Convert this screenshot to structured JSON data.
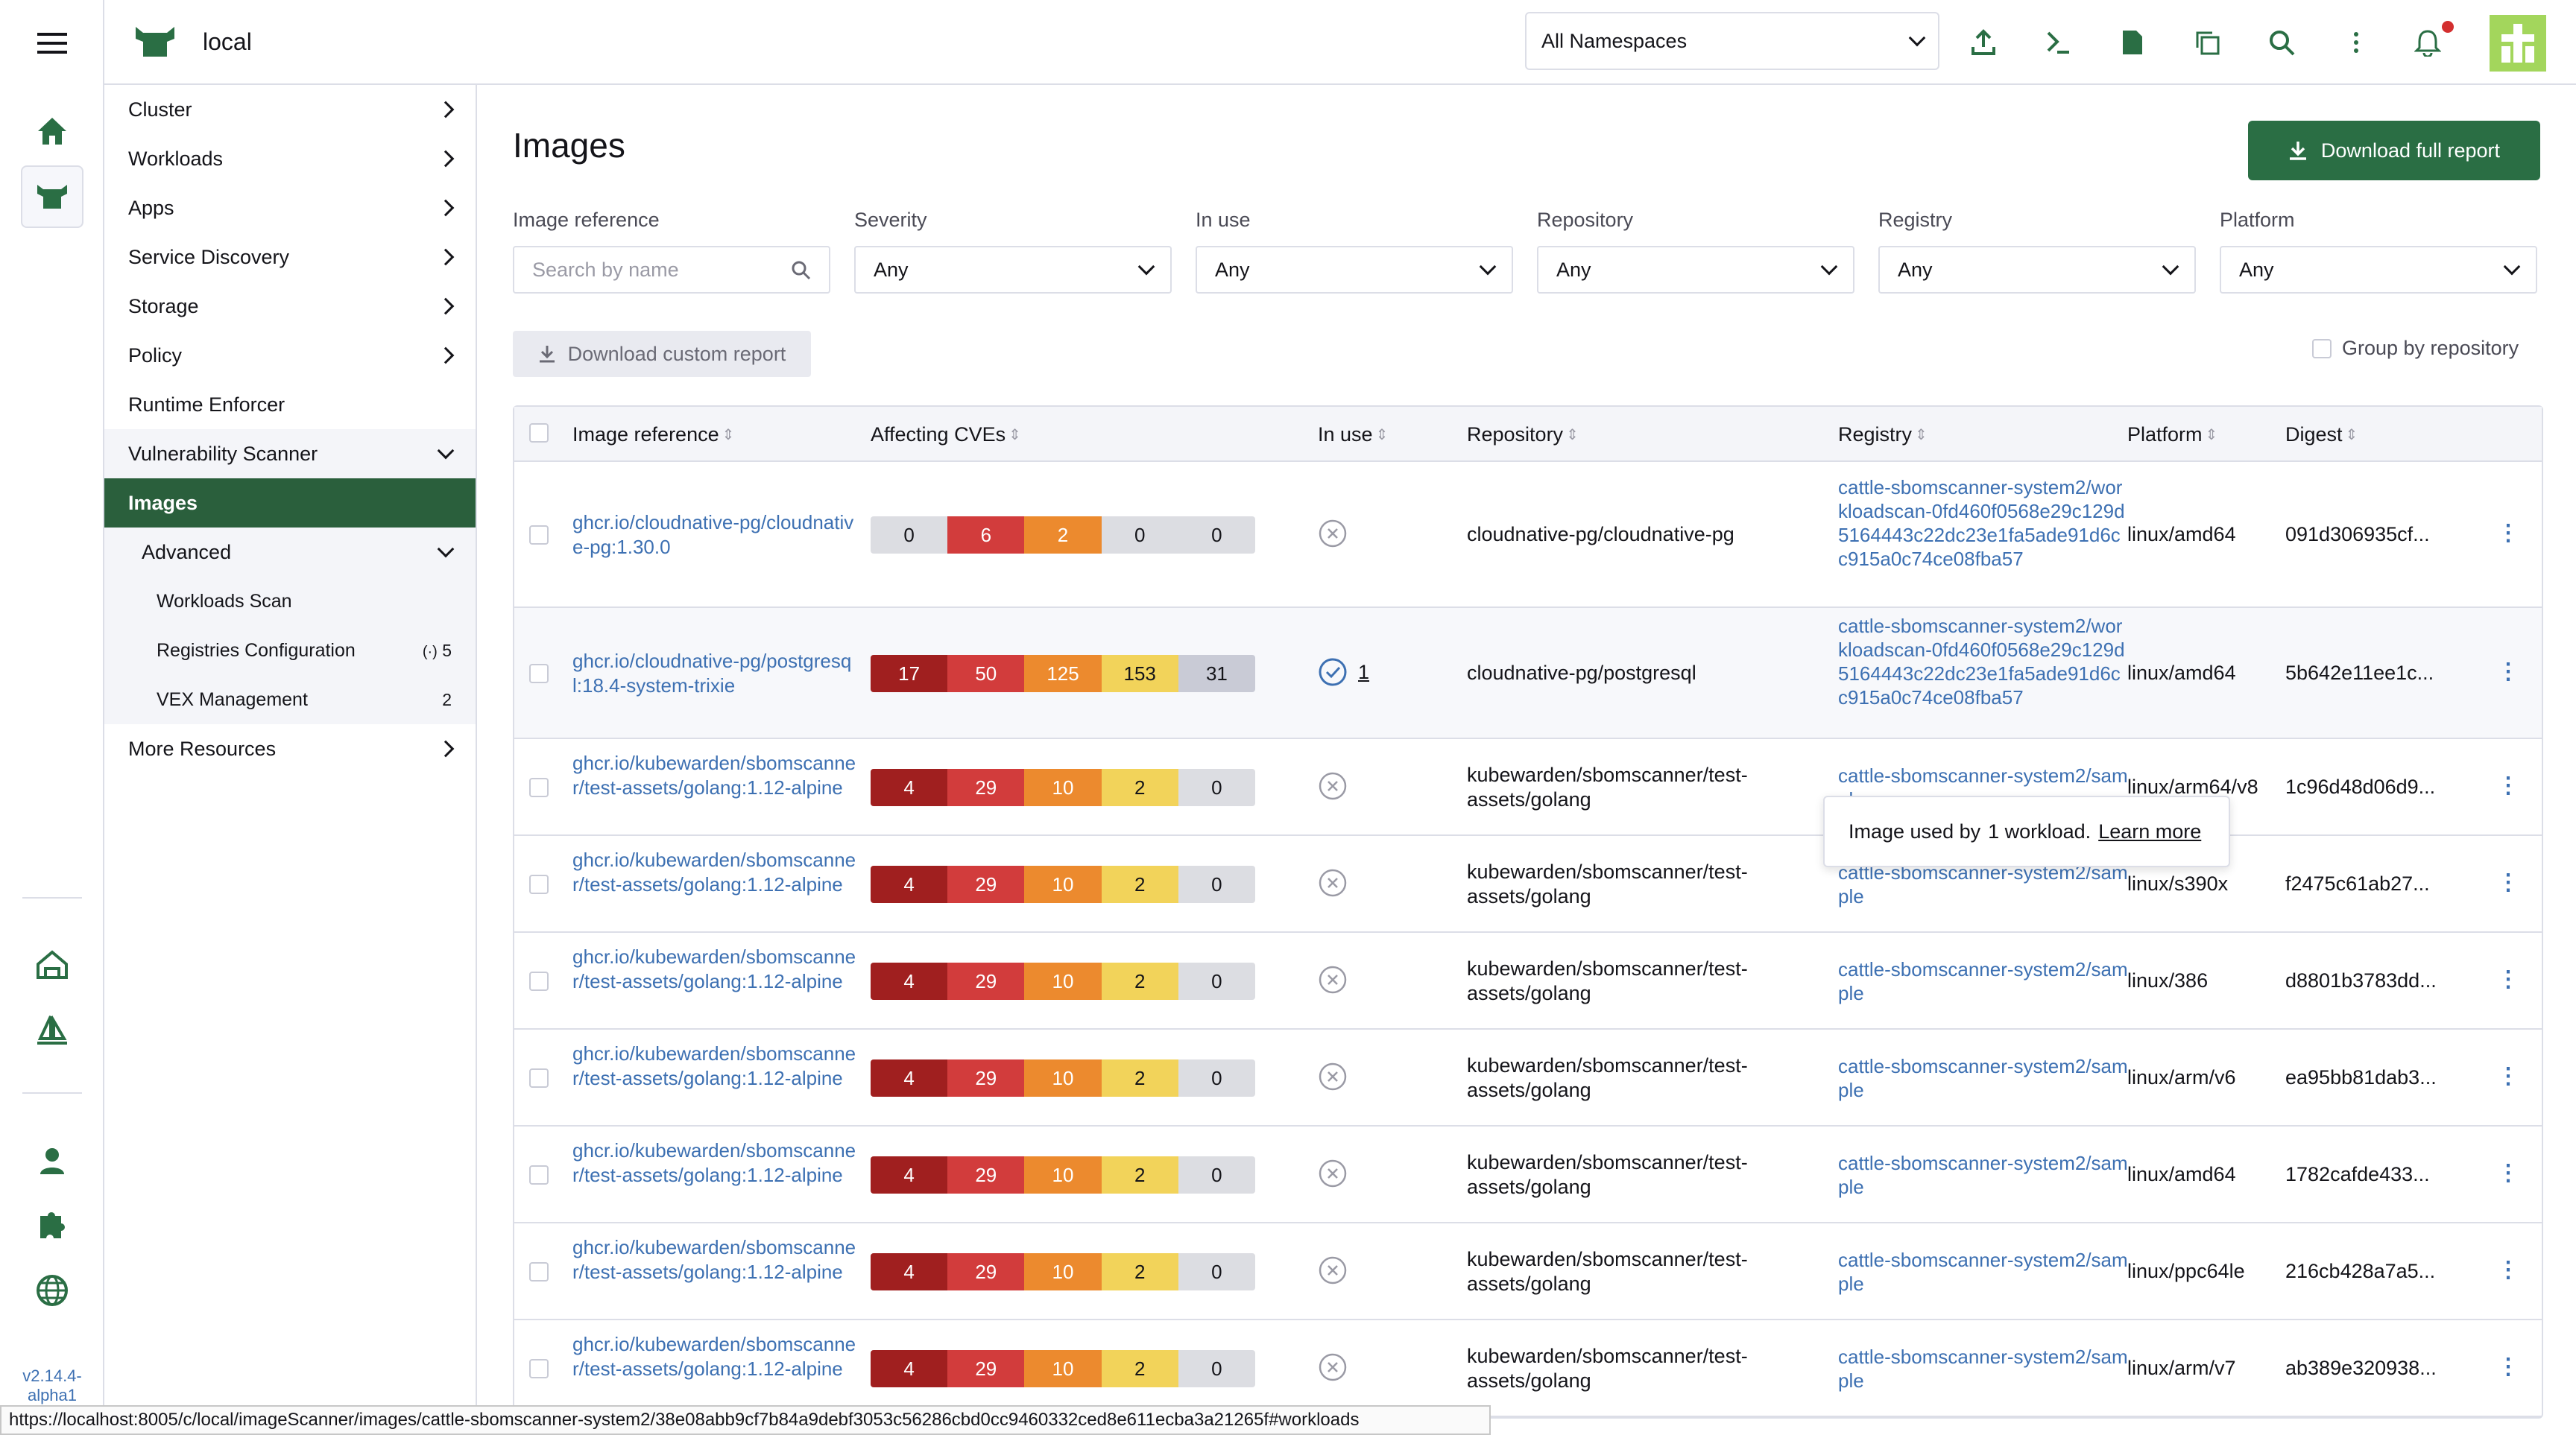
{
  "app": {
    "cluster_name": "local",
    "version": "v2.14.4-\nalpha1",
    "colors": {
      "primary": "#2a6e44",
      "link": "#3d70b2",
      "selected_nav": "#2a5f3c"
    }
  },
  "header": {
    "namespace_select": "All Namespaces",
    "icons": [
      "upload-icon",
      "terminal-icon",
      "file-icon",
      "copy-icon",
      "search-icon",
      "more-icon",
      "bell-icon"
    ]
  },
  "nav": {
    "items": [
      {
        "label": "Cluster",
        "chevron": "right"
      },
      {
        "label": "Workloads",
        "chevron": "right"
      },
      {
        "label": "Apps",
        "chevron": "right"
      },
      {
        "label": "Service Discovery",
        "chevron": "right"
      },
      {
        "label": "Storage",
        "chevron": "right"
      },
      {
        "label": "Policy",
        "chevron": "right"
      },
      {
        "label": "Runtime Enforcer",
        "chevron": ""
      },
      {
        "label": "Vulnerability Scanner",
        "chevron": "down"
      },
      {
        "label": "Images",
        "chevron": ""
      },
      {
        "label": "Advanced",
        "chevron": "down"
      },
      {
        "label": "Workloads Scan",
        "badge": ""
      },
      {
        "label": "Registries Configuration",
        "badge": "5"
      },
      {
        "label": "VEX Management",
        "badge": "2"
      },
      {
        "label": "More Resources",
        "chevron": "right"
      }
    ]
  },
  "page": {
    "title": "Images",
    "download_full": "Download full report",
    "download_custom": "Download custom report",
    "group_by": "Group by repository",
    "filters": [
      {
        "label": "Image reference",
        "value": "",
        "placeholder": "Search by name"
      },
      {
        "label": "Severity",
        "value": "Any"
      },
      {
        "label": "In use",
        "value": "Any"
      },
      {
        "label": "Repository",
        "value": "Any"
      },
      {
        "label": "Registry",
        "value": "Any"
      },
      {
        "label": "Platform",
        "value": "Any"
      }
    ]
  },
  "table": {
    "columns": [
      "Image reference",
      "Affecting CVEs",
      "In use",
      "Repository",
      "Registry",
      "Platform",
      "Digest"
    ],
    "cve_colors": [
      "#dcdde2",
      "#a01f1f",
      "#d23c3c",
      "#ec8a2e",
      "#f2d35a",
      "#c9cbd6"
    ],
    "rows": [
      {
        "ref": "ghcr.io/cloudnative-pg/cloudnative-pg:1.30.0",
        "cves": [
          "0",
          "6",
          "2",
          "0",
          "0"
        ],
        "in_use": "",
        "repo": "cloudnative-pg/cloudnative-pg",
        "registry": "cattle-sbomscanner-system2/workloadscan-0fd460f0568e29c129d5164443c22dc23e1fa5ade91d6cc915a0c74ce08fba57",
        "platform": "linux/amd64",
        "digest": "091d306935cf..."
      },
      {
        "ref": "ghcr.io/cloudnative-pg/postgresql:18.4-system-trixie",
        "cves": [
          "17",
          "50",
          "125",
          "153",
          "31"
        ],
        "in_use": "1",
        "repo": "cloudnative-pg/postgresql",
        "registry": "cattle-sbomscanner-system2/workloadscan-0fd460f0568e29c129d5164443c22dc23e1fa5ade91d6cc915a0c74ce08fba57",
        "platform": "linux/amd64",
        "digest": "5b642e11ee1c..."
      },
      {
        "ref": "ghcr.io/kubewarden/sbomscanner/test-assets/golang:1.12-alpine",
        "cves": [
          "4",
          "29",
          "10",
          "2",
          "0"
        ],
        "in_use": "",
        "repo": "kubewarden/sbomscanner/test-assets/golang",
        "registry": "cattle-sbomscanner-system2/sample",
        "platform": "linux/arm64/v8",
        "digest": "1c96d48d06d9..."
      },
      {
        "ref": "ghcr.io/kubewarden/sbomscanner/test-assets/golang:1.12-alpine",
        "cves": [
          "4",
          "29",
          "10",
          "2",
          "0"
        ],
        "in_use": "",
        "repo": "kubewarden/sbomscanner/test-assets/golang",
        "registry": "cattle-sbomscanner-system2/sample",
        "platform": "linux/s390x",
        "digest": "f2475c61ab27..."
      },
      {
        "ref": "ghcr.io/kubewarden/sbomscanner/test-assets/golang:1.12-alpine",
        "cves": [
          "4",
          "29",
          "10",
          "2",
          "0"
        ],
        "in_use": "",
        "repo": "kubewarden/sbomscanner/test-assets/golang",
        "registry": "cattle-sbomscanner-system2/sample",
        "platform": "linux/386",
        "digest": "d8801b3783dd..."
      },
      {
        "ref": "ghcr.io/kubewarden/sbomscanner/test-assets/golang:1.12-alpine",
        "cves": [
          "4",
          "29",
          "10",
          "2",
          "0"
        ],
        "in_use": "",
        "repo": "kubewarden/sbomscanner/test-assets/golang",
        "registry": "cattle-sbomscanner-system2/sample",
        "platform": "linux/arm/v6",
        "digest": "ea95bb81dab3..."
      },
      {
        "ref": "ghcr.io/kubewarden/sbomscanner/test-assets/golang:1.12-alpine",
        "cves": [
          "4",
          "29",
          "10",
          "2",
          "0"
        ],
        "in_use": "",
        "repo": "kubewarden/sbomscanner/test-assets/golang",
        "registry": "cattle-sbomscanner-system2/sample",
        "platform": "linux/amd64",
        "digest": "1782cafde433..."
      },
      {
        "ref": "ghcr.io/kubewarden/sbomscanner/test-assets/golang:1.12-alpine",
        "cves": [
          "4",
          "29",
          "10",
          "2",
          "0"
        ],
        "in_use": "",
        "repo": "kubewarden/sbomscanner/test-assets/golang",
        "registry": "cattle-sbomscanner-system2/sample",
        "platform": "linux/ppc64le",
        "digest": "216cb428a7a5..."
      },
      {
        "ref": "ghcr.io/kubewarden/sbomscanner/test-assets/golang:1.12-alpine",
        "cves": [
          "4",
          "29",
          "10",
          "2",
          "0"
        ],
        "in_use": "",
        "repo": "kubewarden/sbomscanner/test-assets/golang",
        "registry": "cattle-sbomscanner-system2/sample",
        "platform": "linux/arm/v7",
        "digest": "ab389e320938..."
      }
    ]
  },
  "tooltip": {
    "prefix": "Image used by",
    "count": "1 workload.",
    "link": "Learn more"
  },
  "statusbar": "https://localhost:8005/c/local/imageScanner/images/cattle-sbomscanner-system2/38e08abb9cf7b84a9debf3053c56286cbd0cc9460332ced8e611ecba3a21265f#workloads"
}
